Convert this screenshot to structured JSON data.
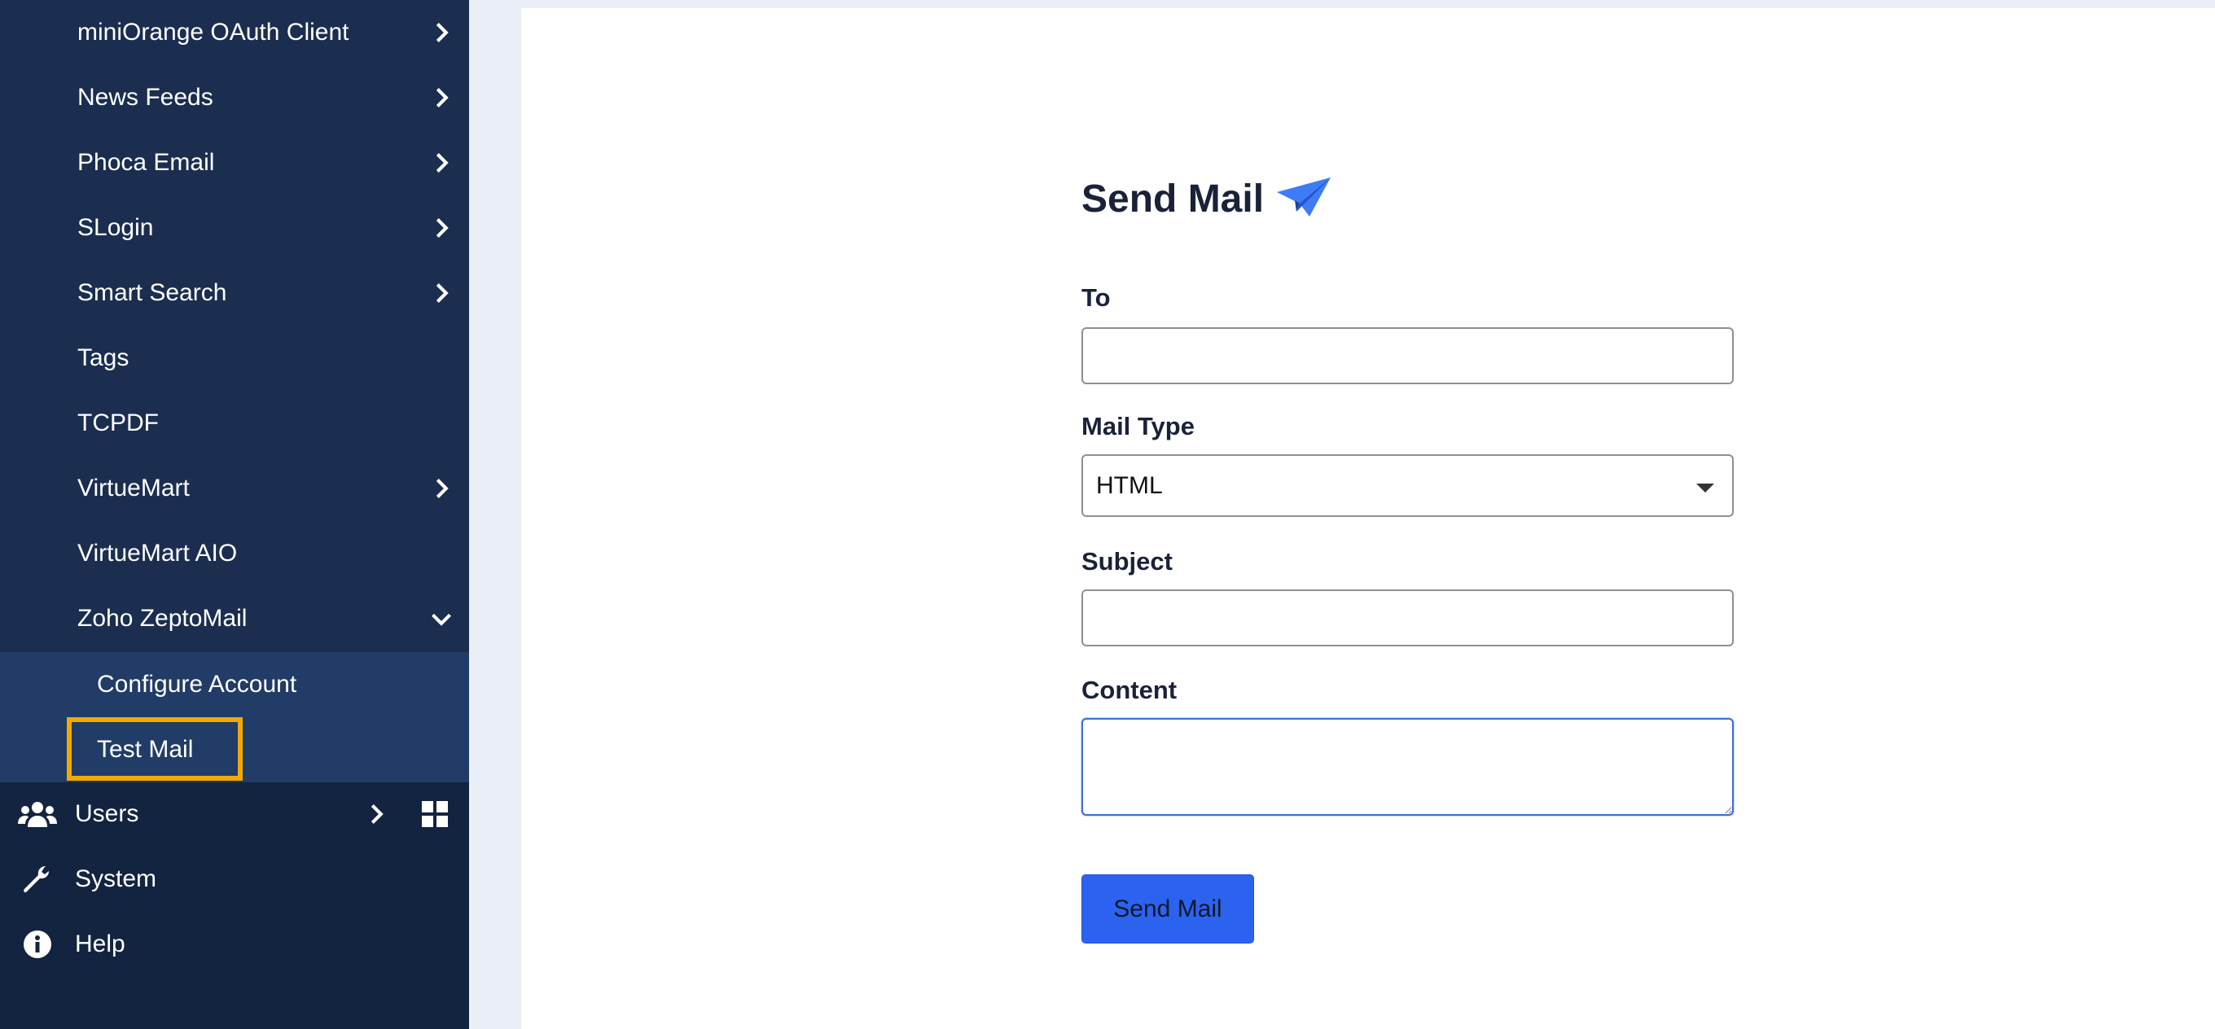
{
  "sidebar": {
    "items": [
      {
        "label": "miniOrange OAuth Client",
        "chevron": "right"
      },
      {
        "label": "News Feeds",
        "chevron": "right"
      },
      {
        "label": "Phoca Email",
        "chevron": "right"
      },
      {
        "label": "SLogin",
        "chevron": "right"
      },
      {
        "label": "Smart Search",
        "chevron": "right"
      },
      {
        "label": "Tags",
        "chevron": ""
      },
      {
        "label": "TCPDF",
        "chevron": ""
      },
      {
        "label": "VirtueMart",
        "chevron": "right"
      },
      {
        "label": "VirtueMart AIO",
        "chevron": ""
      },
      {
        "label": "Zoho ZeptoMail",
        "chevron": "down"
      }
    ],
    "subitems": [
      {
        "label": "Configure Account"
      },
      {
        "label": "Test Mail",
        "highlighted": true
      }
    ],
    "main": [
      {
        "label": "Users",
        "icon": "users-icon"
      },
      {
        "label": "System",
        "icon": "wrench-icon"
      },
      {
        "label": "Help",
        "icon": "info-icon"
      }
    ]
  },
  "form": {
    "title": "Send Mail",
    "to_label": "To",
    "to_value": "",
    "mail_type_label": "Mail Type",
    "mail_type_value": "HTML",
    "subject_label": "Subject",
    "subject_value": "",
    "content_label": "Content",
    "content_value": "",
    "submit_label": "Send Mail"
  },
  "colors": {
    "sidebar_bg": "#132440",
    "sidebar_section_bg": "#1b2e4f",
    "submenu_bg": "#213c66",
    "highlight": "#f2a900",
    "accent": "#2b63f0"
  }
}
